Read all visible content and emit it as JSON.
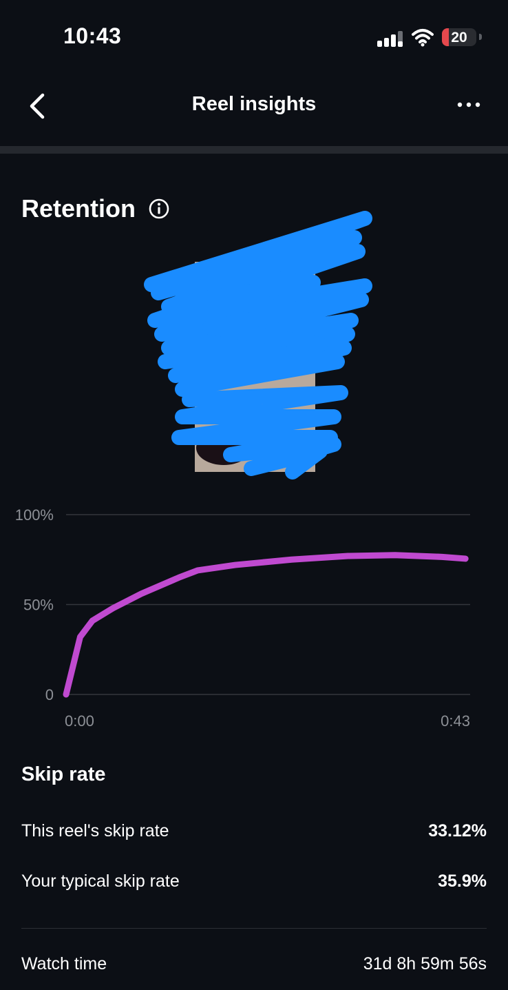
{
  "status_bar": {
    "time": "10:43",
    "battery_level": "20",
    "battery_fraction": 0.2,
    "icons": [
      "signal-icon",
      "wifi-icon",
      "battery-icon"
    ]
  },
  "header": {
    "title": "Reel insights",
    "back_icon": "chevron-left-icon",
    "more_icon": "more-horizontal-icon"
  },
  "retention": {
    "title": "Retention",
    "info_icon": "info-icon"
  },
  "chart_data": {
    "type": "line",
    "x_tick_labels": [
      "0:00",
      "0:43"
    ],
    "y_tick_labels": [
      "100%",
      "50%",
      "0"
    ],
    "y_ticks": [
      100,
      50,
      0
    ],
    "xlim": [
      0,
      43
    ],
    "ylim": [
      0,
      100
    ],
    "grid": true,
    "series": [
      {
        "color": "#c04ad0",
        "x": [
          0,
          1.5,
          2.8,
          5,
          8,
          12,
          14,
          18,
          24,
          30,
          35,
          40,
          42.5
        ],
        "y": [
          0,
          32,
          41,
          48,
          56,
          65,
          69,
          72,
          75,
          77,
          77.5,
          76.5,
          75.5
        ]
      }
    ]
  },
  "skip_rate": {
    "title": "Skip rate",
    "rows": [
      {
        "label": "This reel's skip rate",
        "value": "33.12%"
      },
      {
        "label": "Your typical skip rate",
        "value": "35.9%"
      }
    ]
  },
  "watch_time": {
    "label": "Watch time",
    "value": "31d 8h 59m 56s"
  },
  "colors": {
    "background": "#0c0f15",
    "line": "#c04ad0",
    "scribble": "#1a8cff",
    "battery_low": "#e5484d"
  }
}
